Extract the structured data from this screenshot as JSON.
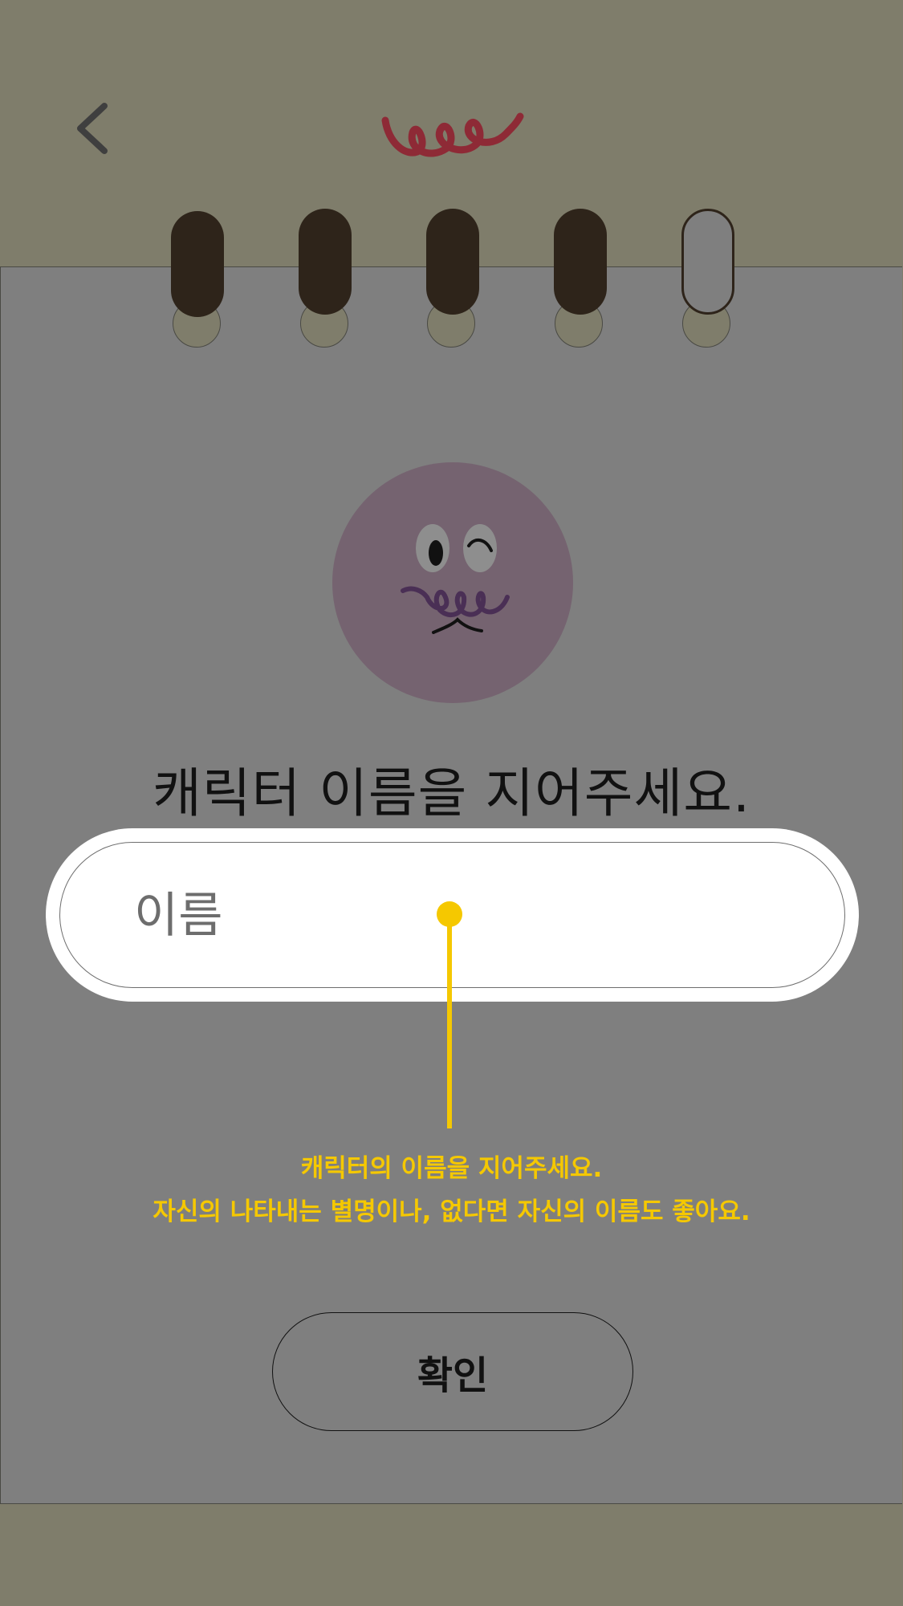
{
  "header": {
    "back_icon": "chevron-left-icon",
    "logo_icon": "squiggle-logo-icon",
    "logo_color": "#8e2a36"
  },
  "binder": {
    "ring_count": 5,
    "active_ring_color": "#2e241a",
    "empty_ring_color": "#7f7f7f",
    "progress": "4 of 5"
  },
  "avatar": {
    "icon": "winking-character-face-icon",
    "color": "#756370"
  },
  "form": {
    "title": "캐릭터 이름을 지어주세요.",
    "name_placeholder": "이름",
    "name_value": ""
  },
  "tooltip": {
    "line1": "캐릭터의 이름을 지어주세요.",
    "line2": "자신의 나타내는 별명이나, 없다면 자신의 이름도 좋아요.",
    "color": "#f5c800"
  },
  "actions": {
    "confirm_label": "확인"
  }
}
